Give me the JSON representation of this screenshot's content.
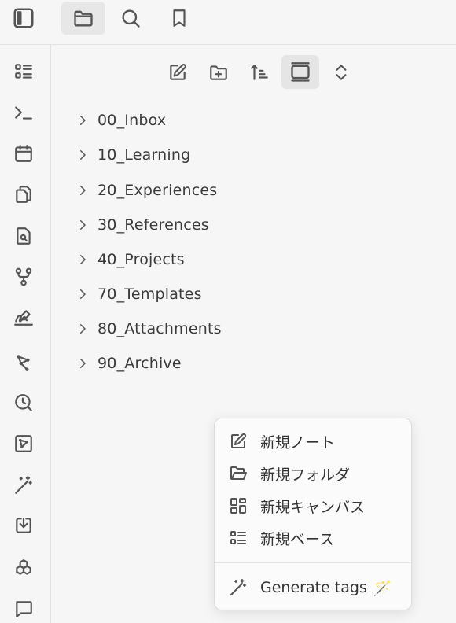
{
  "topbar": {
    "buttons": [
      {
        "icon": "sidebar-toggle-icon"
      },
      {
        "icon": "folder-icon",
        "active": true
      },
      {
        "icon": "search-icon"
      },
      {
        "icon": "bookmark-icon"
      }
    ]
  },
  "ribbon": {
    "icons": [
      "list-icon",
      "terminal-icon",
      "calendar-icon",
      "copy-icon",
      "file-search-icon",
      "git-fork-icon",
      "signature-icon",
      "graph-icon",
      "search-clock-icon",
      "canvas-icon",
      "magic-wand-icon",
      "download-icon",
      "boxes-icon",
      "message-icon"
    ]
  },
  "file_nav": {
    "buttons": [
      "new-note-icon",
      "new-folder-icon",
      "sort-icon",
      "collapse-view-icon",
      "expand-collapse-icon"
    ]
  },
  "folders": [
    {
      "label": "00_Inbox"
    },
    {
      "label": "10_Learning"
    },
    {
      "label": "20_Experiences"
    },
    {
      "label": "30_References"
    },
    {
      "label": "40_Projects"
    },
    {
      "label": "70_Templates"
    },
    {
      "label": "80_Attachments"
    },
    {
      "label": "90_Archive"
    }
  ],
  "context_menu": {
    "items": [
      {
        "label": "新規ノート",
        "icon": "edit-icon"
      },
      {
        "label": "新規フォルダ",
        "icon": "folder-open-icon"
      },
      {
        "label": "新規キャンバス",
        "icon": "layout-dashboard-icon"
      },
      {
        "label": "新規ベース",
        "icon": "list-icon"
      }
    ],
    "generate": {
      "label": "Generate tags",
      "emoji": "🪄"
    }
  }
}
